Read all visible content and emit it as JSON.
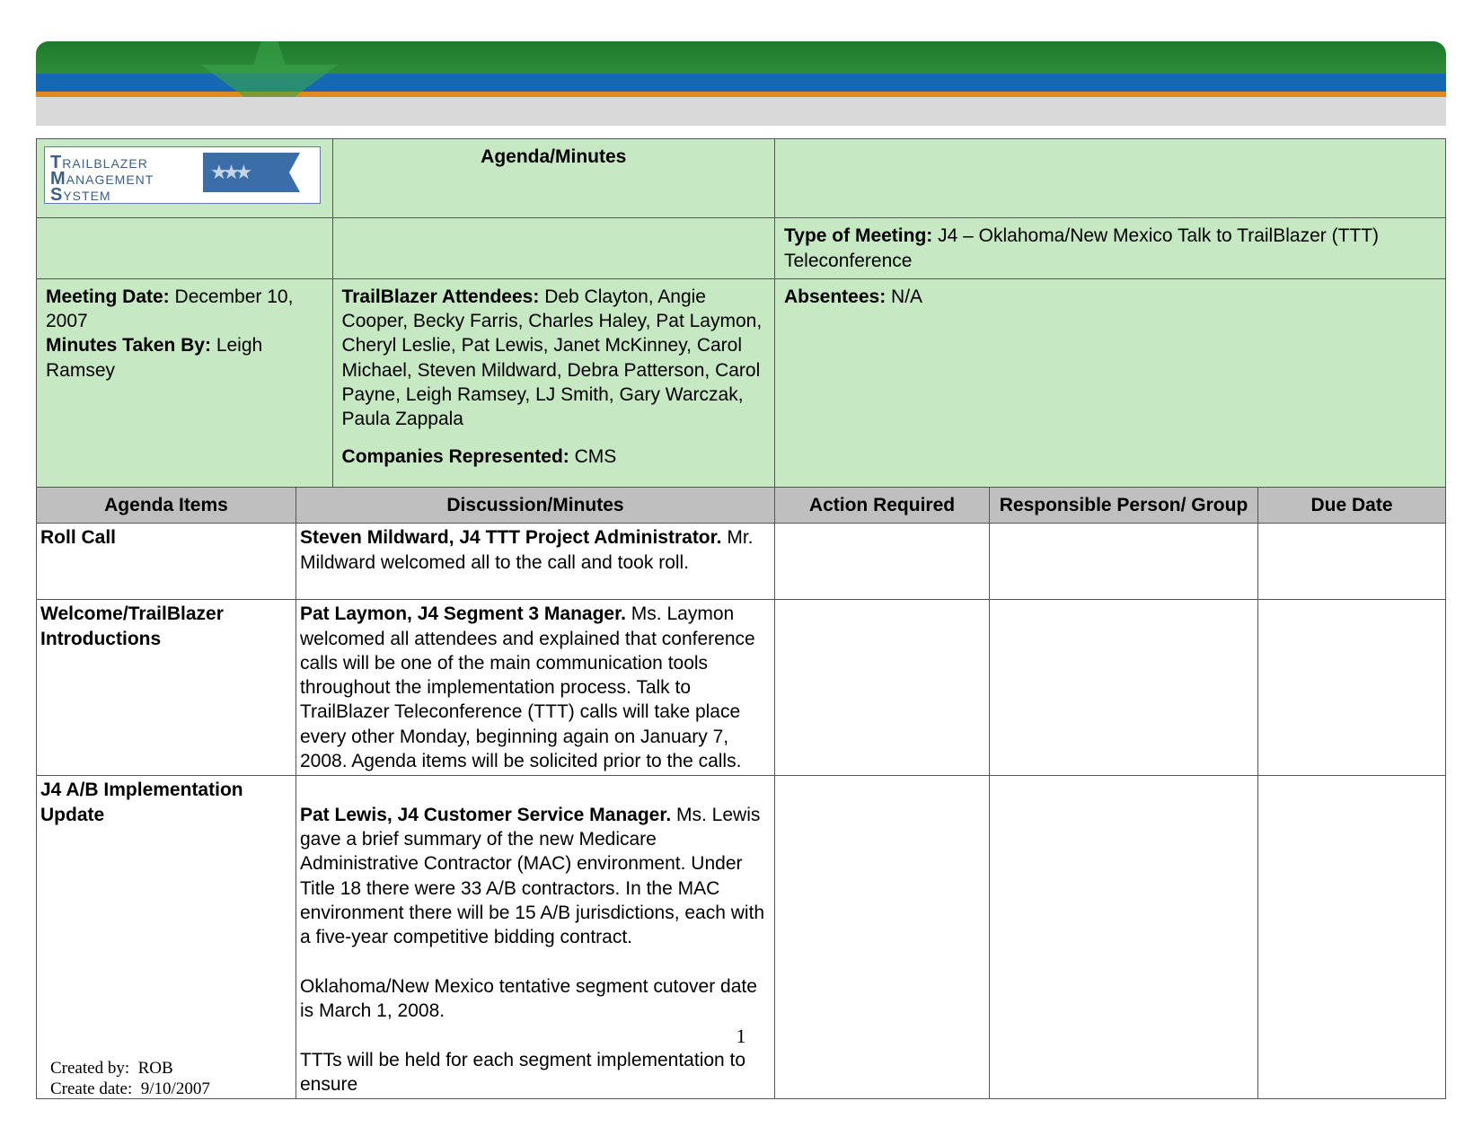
{
  "banner": {
    "logo_line1": "TRAILBLAZER",
    "logo_line2": "MANAGEMENT",
    "logo_line3": "SYSTEM"
  },
  "title": "Agenda/Minutes",
  "meeting_type_label": "Type of Meeting:",
  "meeting_type_value": "J4 – Oklahoma/New Mexico Talk to TrailBlazer (TTT) Teleconference",
  "meeting_date_label": "Meeting Date:",
  "meeting_date_value": "December 10, 2007",
  "minutes_taken_by_label": "Minutes Taken By:",
  "minutes_taken_by_value": "Leigh Ramsey",
  "attendees_label": "TrailBlazer Attendees:",
  "attendees_value": "Deb Clayton, Angie Cooper, Becky Farris, Charles Haley, Pat Laymon, Cheryl Leslie, Pat Lewis, Janet McKinney, Carol Michael, Steven Mildward, Debra Patterson, Carol Payne, Leigh Ramsey, LJ Smith, Gary Warczak, Paula Zappala",
  "companies_label": "Companies Represented:",
  "companies_value": "CMS",
  "absentees_label": "Absentees:",
  "absentees_value": "N/A",
  "cols": {
    "agenda": "Agenda Items",
    "discussion": "Discussion/Minutes",
    "action": "Action Required",
    "responsible": "Responsible Person/ Group",
    "due": "Due Date"
  },
  "rows": [
    {
      "agenda": "Roll Call",
      "disc_bold": "Steven Mildward, J4 TTT Project Administrator.",
      "disc_rest": " Mr. Mildward welcomed all to the call and took roll.",
      "action": "",
      "responsible": "",
      "due": ""
    },
    {
      "agenda": "Welcome/TrailBlazer Introductions",
      "disc_bold": "Pat Laymon, J4 Segment 3 Manager.",
      "disc_rest": " Ms. Laymon welcomed all attendees and explained that conference calls will be one of the main communication tools throughout the implementation process. Talk to TrailBlazer Teleconference (TTT) calls will take place every other Monday, beginning again on January 7, 2008. Agenda items will be solicited prior to the calls.",
      "action": "",
      "responsible": "",
      "due": ""
    },
    {
      "agenda": "J4 A/B Implementation Update",
      "disc_bold": "Pat Lewis, J4 Customer Service Manager.",
      "disc_rest": " Ms. Lewis gave a brief summary of the new Medicare Administrative Contractor (MAC) environment. Under Title 18 there were 33 A/B contractors. In the MAC environment there will be 15 A/B jurisdictions, each with a five-year competitive bidding contract.\n\nOklahoma/New Mexico tentative segment cutover date is March 1, 2008.\n\nTTTs will be held for each segment implementation to ensure",
      "action": "",
      "responsible": "",
      "due": ""
    }
  ],
  "page_number": "1",
  "footer": {
    "created_by_label": "Created by:",
    "created_by_value": "ROB",
    "create_date_label": "Create date:",
    "create_date_value": "9/10/2007"
  }
}
